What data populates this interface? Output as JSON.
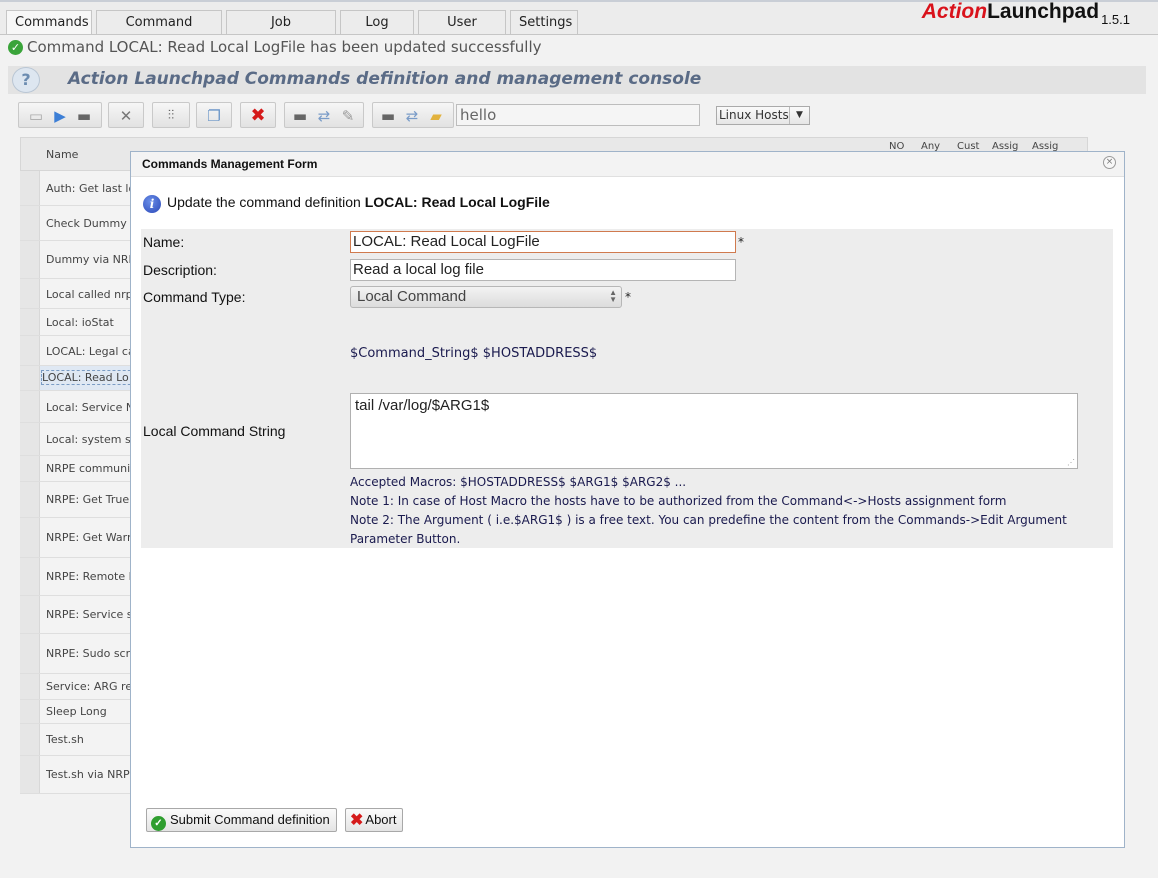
{
  "tabs": [
    "Commands",
    "Command Groups",
    "Job Scheduling",
    "Log View",
    "User Mgmt.",
    "Settings"
  ],
  "brand": {
    "action": "Action",
    "launchpad": "Launchpad",
    "version": "1.5.1"
  },
  "status_message": "Command LOCAL: Read Local LogFile has been updated successfully",
  "console_title": "Action Launchpad Commands definition and management console",
  "help_glyph": "?",
  "toolbar": {
    "filter_value": "hello",
    "host_group": "Linux Hosts",
    "icons": [
      "new-icon",
      "run-icon",
      "console-icon",
      "tools-icon",
      "settings-sliders-icon",
      "copy-icon",
      "delete-icon",
      "terminal-icon",
      "transfer-icon",
      "paint-icon",
      "terminal2-icon",
      "transfer2-icon",
      "folder-icon"
    ]
  },
  "grid": {
    "name_header": "Name",
    "small_headers": [
      "NO",
      "Any",
      "Cust",
      "Assig",
      "Assig"
    ],
    "rows": [
      "Auth: Get last log",
      "Check Dummy vi",
      "Dummy via NRPE",
      "Local called nrpe",
      "Local: ioStat",
      "LOCAL: Legal cat",
      "LOCAL: Read Lo",
      "Local: Service Na",
      "Local: system sta",
      "NRPE communica",
      "NRPE: Get True",
      "NRPE: Get Warn",
      "NRPE: Remote R",
      "NRPE: Service st",
      "NRPE: Sudo scrip",
      "Service: ARG res",
      "Sleep Long",
      "Test.sh",
      "Test.sh via NRPE"
    ]
  },
  "dialog": {
    "title": "Commands Management Form",
    "close_glyph": "×",
    "update_prefix": "Update the command definition",
    "update_command": "LOCAL: Read Local LogFile",
    "info_glyph": "i",
    "fields": {
      "name_label": "Name:",
      "name_value": "LOCAL: Read Local LogFile",
      "description_label": "Description:",
      "description_value": "Read a local log file",
      "command_type_label": "Command Type:",
      "command_type_value": "Local Command",
      "required_mark": "*",
      "command_template": "$Command_String$ $HOSTADDRESS$",
      "local_command_label": "Local Command String",
      "local_command_value": "tail /var/log/$ARG1$"
    },
    "notes": {
      "macros": "Accepted Macros: $HOSTADDRESS$ $ARG1$ $ARG2$ ...",
      "note1": "Note 1: In case of Host Macro the hosts have to be authorized from the Command<->Hosts assignment form",
      "note2a": "Note 2: The Argument ( i.e.$ARG1$ ) is a free text. You can predefine the content from the Commands->Edit Argument",
      "note2b": "Parameter Button."
    },
    "submit_label": "Submit Command definition",
    "abort_label": "Abort"
  }
}
